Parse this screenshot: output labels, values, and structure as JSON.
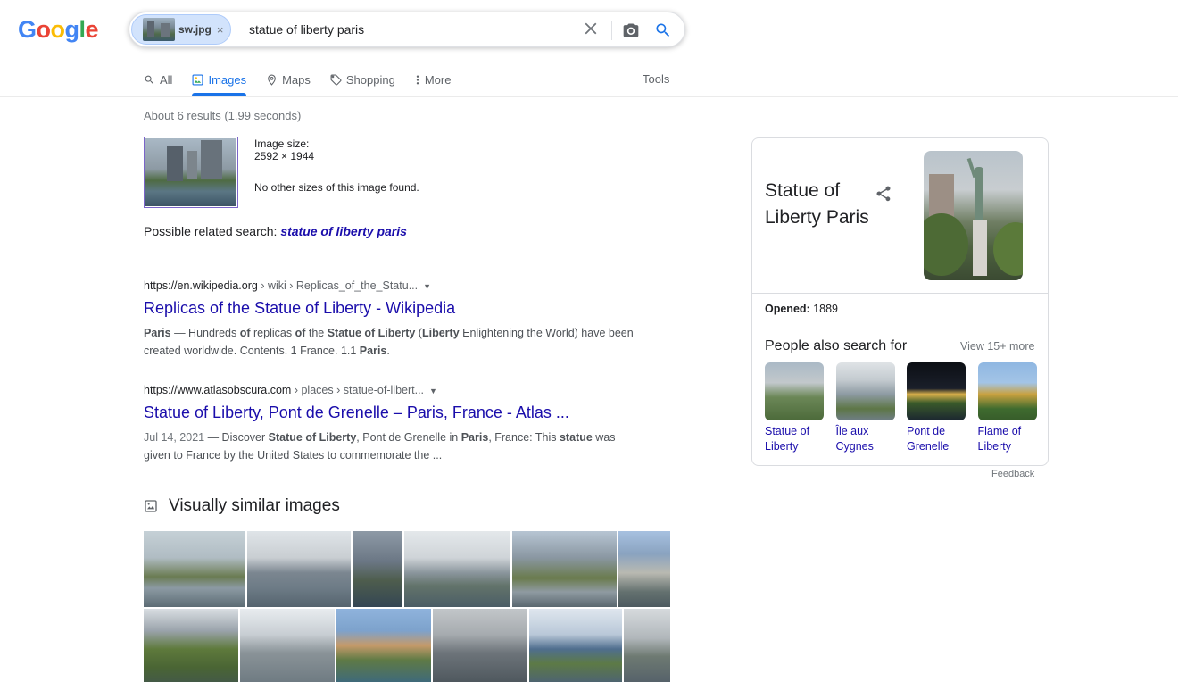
{
  "logo": {
    "letters": [
      "G",
      "o",
      "o",
      "g",
      "l",
      "e"
    ],
    "colors": [
      "#4285f4",
      "#ea4335",
      "#fbbc05",
      "#4285f4",
      "#34a853",
      "#ea4335"
    ]
  },
  "search": {
    "chip_name": "sw.jpg",
    "chip_close": "×",
    "query": "statue of liberty paris",
    "clear": "✕"
  },
  "tabs": [
    {
      "label": "All",
      "icon": "search-icon",
      "active": false
    },
    {
      "label": "Images",
      "icon": "image-icon",
      "active": true
    },
    {
      "label": "Maps",
      "icon": "map-pin-icon",
      "active": false
    },
    {
      "label": "Shopping",
      "icon": "tag-icon",
      "active": false
    },
    {
      "label": "More",
      "icon": "more-vert-icon",
      "active": false
    }
  ],
  "tools": "Tools",
  "stats": "About 6 results (1.99 seconds)",
  "query_image": {
    "size_label": "Image size:",
    "size_value": "2592 × 1944",
    "no_other": "No other sizes of this image found."
  },
  "related": {
    "prefix": "Possible related search: ",
    "link": "statue of liberty paris"
  },
  "results": [
    {
      "url_host": "https://en.wikipedia.org",
      "url_path": " › wiki › Replicas_of_the_Statu...",
      "title": "Replicas of the Statue of Liberty - Wikipedia"
    },
    {
      "url_host": "https://www.atlasobscura.com",
      "url_path": " › places › statue-of-libert...",
      "title": "Statue of Liberty, Pont de Grenelle – Paris, France - Atlas ...",
      "date": "Jul 14, 2021"
    }
  ],
  "visually_similar": "Visually similar images",
  "knowledge_panel": {
    "title": "Statue of Liberty Paris",
    "opened_label": "Opened:",
    "opened_value": " 1889",
    "people_also_search": "People also search for",
    "view_more": "View 15+ more",
    "items": [
      {
        "label": "Statue of Liberty"
      },
      {
        "label": "Île aux Cygnes"
      },
      {
        "label": "Pont de Grenelle"
      },
      {
        "label": "Flame of Liberty"
      }
    ]
  },
  "feedback": "Feedback",
  "colors": {
    "link": "#1a0dab",
    "accent": "#1a73e8",
    "chip_bg": "#d2e3fc"
  }
}
